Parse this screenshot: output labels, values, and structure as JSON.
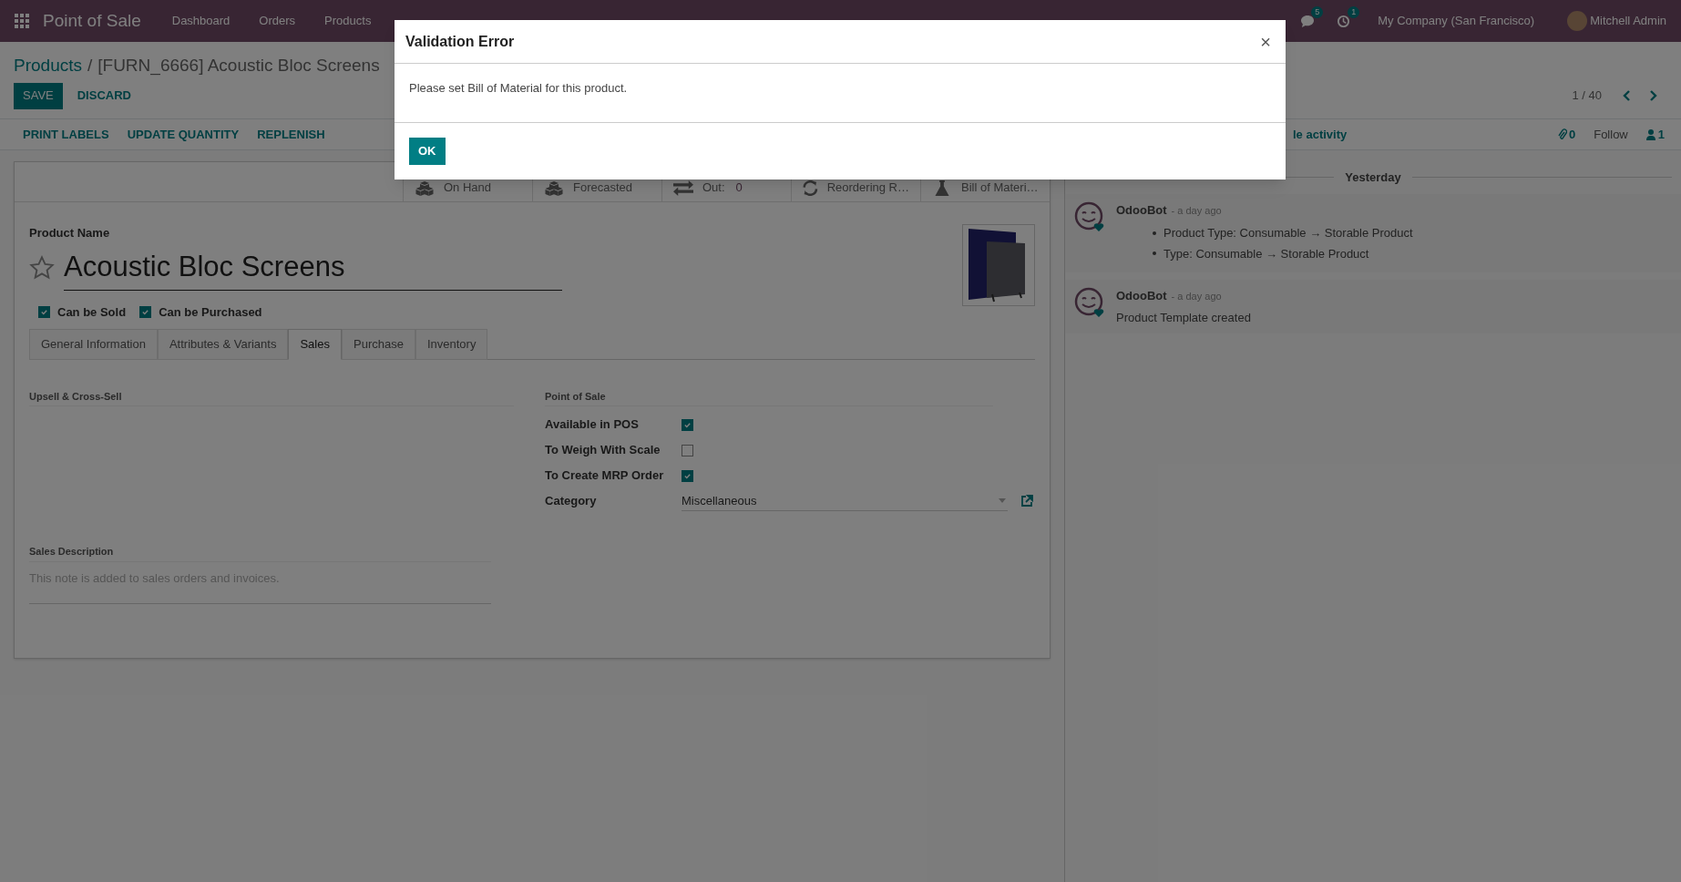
{
  "navbar": {
    "app_title": "Point of Sale",
    "menu": [
      "Dashboard",
      "Orders",
      "Products"
    ],
    "messages_badge": "5",
    "activities_badge": "1",
    "company": "My Company (San Francisco)",
    "user": "Mitchell Admin"
  },
  "breadcrumb": {
    "parent": "Products",
    "separator": "/",
    "current": "[FURN_6666] Acoustic Bloc Screens"
  },
  "buttons": [
    {
      "kind": "primary",
      "label": "SAVE"
    },
    {
      "kind": "link",
      "label": "DISCARD"
    }
  ],
  "pager": "1 / 40",
  "actions": [
    "PRINT LABELS",
    "UPDATE QUANTITY",
    "REPLENISH"
  ],
  "stat_buttons": [
    {
      "kind": "cubes",
      "label": "On Hand"
    },
    {
      "kind": "cubes",
      "label": "Forecasted"
    },
    {
      "kind": "transfer",
      "label": "Out:",
      "value": "0"
    },
    {
      "kind": "refresh",
      "label": "Reordering R…"
    },
    {
      "kind": "flask",
      "label": "Bill of Materi…"
    }
  ],
  "form": {
    "name_label": "Product Name",
    "name": "Acoustic Bloc Screens",
    "favorite": false,
    "flags": [
      {
        "label": "Can be Sold",
        "checked": true
      },
      {
        "label": "Can be Purchased",
        "checked": true
      }
    ],
    "tabs": [
      {
        "label": "General Information",
        "selected": false
      },
      {
        "label": "Attributes & Variants",
        "selected": false
      },
      {
        "label": "Sales",
        "selected": true
      },
      {
        "label": "Purchase",
        "selected": false
      },
      {
        "label": "Inventory",
        "selected": false
      }
    ],
    "sales_tab": {
      "upsell_title": "Upsell & Cross-Sell",
      "pos_title": "Point of Sale",
      "pos_fields": [
        {
          "kind": "checkbox",
          "label": "Available in POS",
          "checked": true
        },
        {
          "kind": "checkbox",
          "label": "To Weigh With Scale",
          "checked": false
        },
        {
          "kind": "checkbox",
          "label": "To Create MRP Order",
          "checked": true
        },
        {
          "kind": "select",
          "label": "Category",
          "value": "Miscellaneous"
        }
      ],
      "description_title": "Sales Description",
      "description_placeholder": "This note is added to sales orders and invoices."
    }
  },
  "chatter": {
    "activity_link": "le activity",
    "attachments": "0",
    "follow": "Follow",
    "followers": "1",
    "date_separator": "Yesterday",
    "messages": [
      {
        "author": "OdooBot",
        "time": "- a day ago",
        "changes": [
          "Product Type: Consumable → Storable Product",
          "Type: Consumable → Storable Product"
        ]
      },
      {
        "author": "OdooBot",
        "time": "- a day ago",
        "body": "Product Template created"
      }
    ]
  },
  "dialog": {
    "title": "Validation Error",
    "close": "×",
    "message": "Please set Bill of Material for this product.",
    "buttons": [
      "OK"
    ]
  }
}
